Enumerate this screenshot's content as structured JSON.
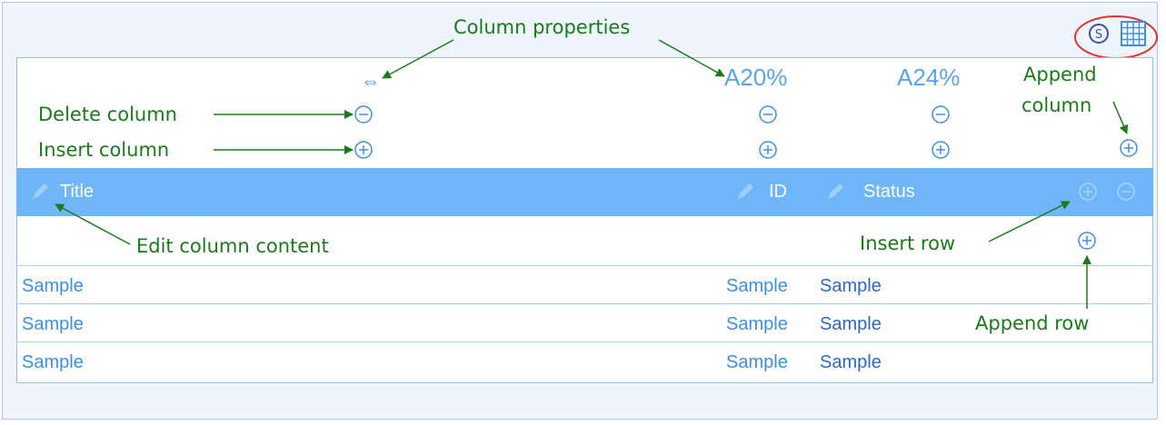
{
  "toolbar": {
    "icons": [
      "s-circle-icon",
      "grid-icon"
    ]
  },
  "column_props": {
    "resize_glyph": "⇔",
    "widths": [
      "A20%",
      "A24%"
    ]
  },
  "header": {
    "columns": [
      "Title",
      "ID",
      "Status"
    ]
  },
  "rows": [
    [
      "Sample",
      "Sample",
      "Sample"
    ],
    [
      "Sample",
      "Sample",
      "Sample"
    ],
    [
      "Sample",
      "Sample",
      "Sample"
    ]
  ],
  "annotations": {
    "column_properties": "Column properties",
    "delete_column": "Delete column",
    "insert_column": "Insert column",
    "append_column_1": "Append",
    "append_column_2": "column",
    "edit_column_content": "Edit column content",
    "insert_row": "Insert row",
    "append_row": "Append row"
  },
  "colors": {
    "header_bg": "#6eb6f8",
    "annotation": "#1b7b1b",
    "icon_blue": "#3c8fe6",
    "highlight_red": "#e03030"
  }
}
